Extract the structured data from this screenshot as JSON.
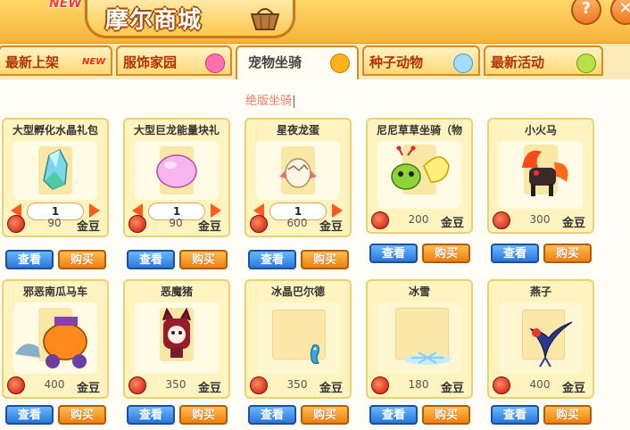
{
  "header": {
    "badge": "NEW",
    "title": "摩尔商城",
    "help": "?",
    "close": "✕"
  },
  "tabs": [
    {
      "label": "最新上架",
      "icon": "new-badge-icon",
      "badge": "NEW"
    },
    {
      "label": "服饰家园",
      "icon": "pink-gift-icon"
    },
    {
      "label": "宠物坐骑",
      "icon": "paw-icon"
    },
    {
      "label": "种子动物",
      "icon": "blue-bubble-icon"
    },
    {
      "label": "最新活动",
      "icon": "green-face-icon"
    }
  ],
  "active_tab": "宠物坐骑",
  "subtitle": "绝版坐骑",
  "actions": {
    "view": "查看",
    "buy": "购买"
  },
  "currency": "金豆",
  "items": [
    {
      "name": "大型孵化水晶礼包",
      "price": "90",
      "qty": "1",
      "icon": "crystal-icon"
    },
    {
      "name": "大型巨龙能量块礼",
      "price": "90",
      "qty": "1",
      "icon": "pink-egg-icon"
    },
    {
      "name": "星夜龙蛋",
      "price": "600",
      "qty": "1",
      "icon": "dragon-egg-icon"
    },
    {
      "name": "尼尼草草坐骑（物",
      "price": "200",
      "qty": "",
      "icon": "butterfly-mount-icon"
    },
    {
      "name": "小火马",
      "price": "300",
      "qty": "",
      "icon": "fire-horse-icon"
    },
    {
      "name": "邪恶南瓜马车",
      "price": "400",
      "qty": "",
      "icon": "pumpkin-carriage-icon"
    },
    {
      "name": "恶魔猪",
      "price": "350",
      "qty": "",
      "icon": "demon-pig-icon"
    },
    {
      "name": "冰晶巴尔德",
      "price": "350",
      "qty": "",
      "icon": "ice-seahorse-icon"
    },
    {
      "name": "冰雪",
      "price": "180",
      "qty": "",
      "icon": "snowflake-icon"
    },
    {
      "name": "燕子",
      "price": "400",
      "qty": "",
      "icon": "swallow-icon"
    }
  ]
}
